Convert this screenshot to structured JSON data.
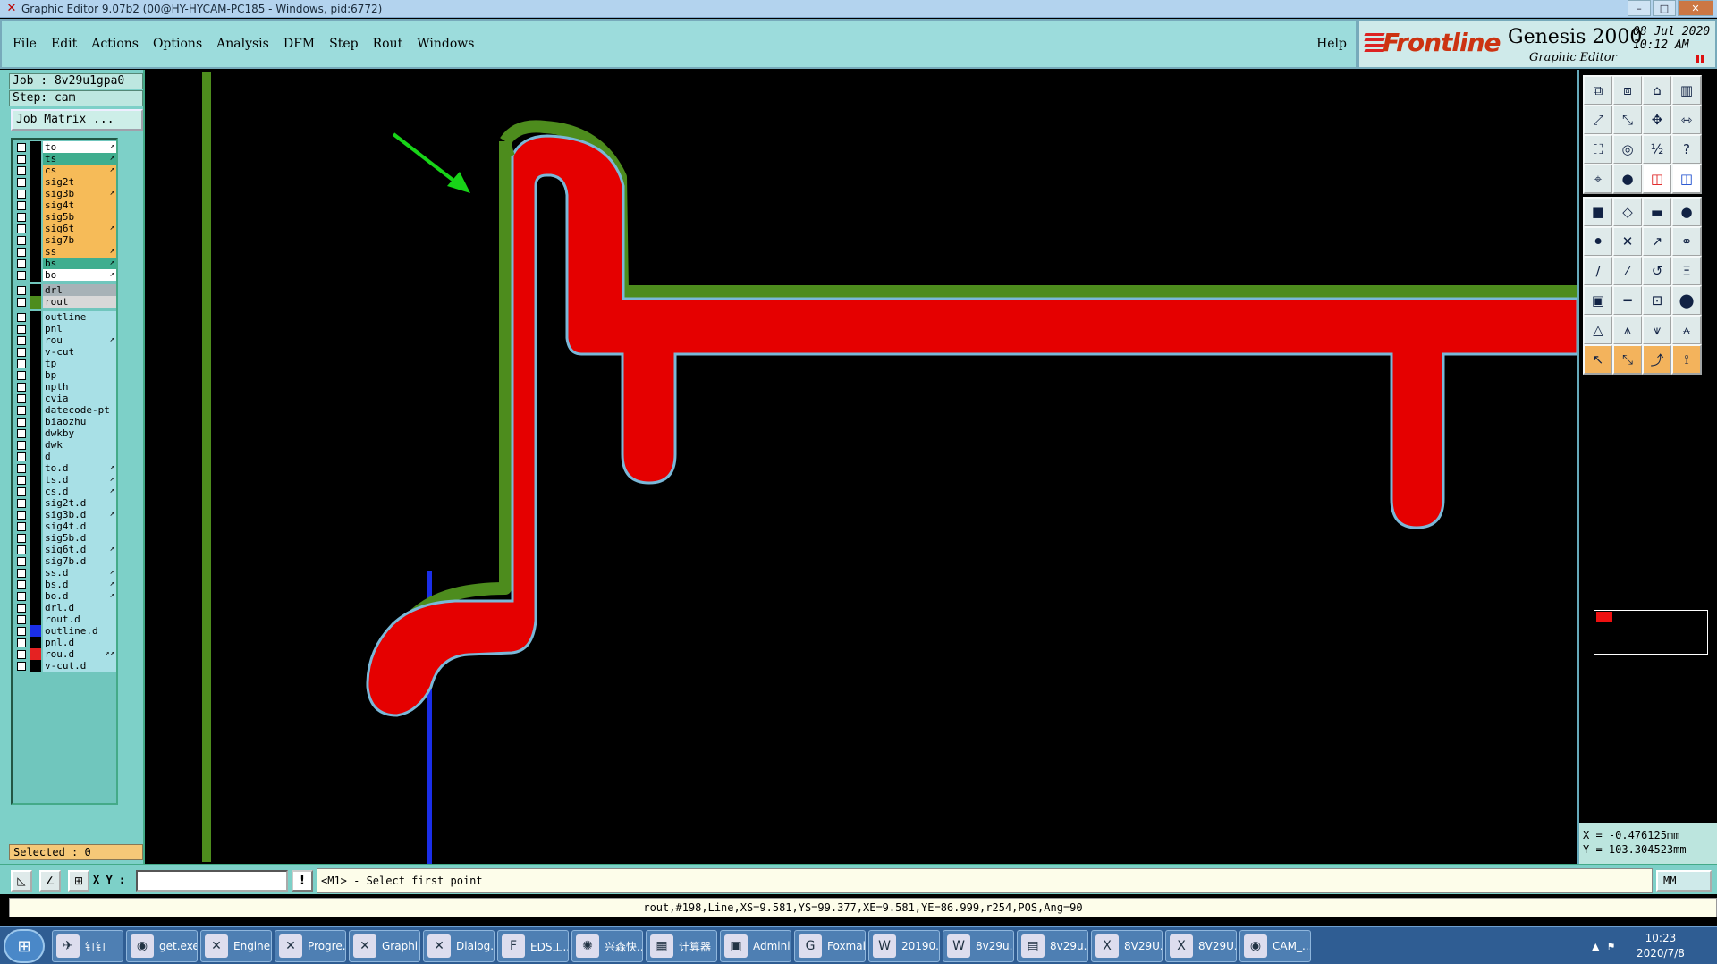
{
  "window": {
    "title": "Graphic Editor 9.07b2 (00@HY-HYCAM-PC185 - Windows, pid:6772)",
    "icon": "app-x-icon"
  },
  "menu": {
    "items": [
      {
        "label": "File"
      },
      {
        "label": "Edit"
      },
      {
        "label": "Actions"
      },
      {
        "label": "Options"
      },
      {
        "label": "Analysis"
      },
      {
        "label": "DFM"
      },
      {
        "label": "Step"
      },
      {
        "label": "Rout"
      },
      {
        "label": "Windows"
      }
    ],
    "help": "Help"
  },
  "brand": {
    "logo_main": "Frontline",
    "product": "Genesis 2000",
    "subtitle": "Graphic Editor",
    "date_line1": "08 Jul 2020",
    "date_line2": "10:12 AM"
  },
  "job": {
    "job": "Job : 8v29u1gpa0",
    "step": "Step: cam",
    "matrix_button": "Job Matrix ..."
  },
  "layers": [
    {
      "name": "to",
      "bg": "#ffffff",
      "mark": "↗"
    },
    {
      "name": "ts",
      "bg": "#3fae8f",
      "mark": "↗"
    },
    {
      "name": "cs",
      "bg": "#f6bb58",
      "mark": "↗"
    },
    {
      "name": "sig2t",
      "bg": "#f6bb58",
      "mark": ""
    },
    {
      "name": "sig3b",
      "bg": "#f6bb58",
      "mark": "↗"
    },
    {
      "name": "sig4t",
      "bg": "#f6bb58",
      "mark": ""
    },
    {
      "name": "sig5b",
      "bg": "#f6bb58",
      "mark": ""
    },
    {
      "name": "sig6t",
      "bg": "#f6bb58",
      "mark": "↗"
    },
    {
      "name": "sig7b",
      "bg": "#f6bb58",
      "mark": ""
    },
    {
      "name": "ss",
      "bg": "#f6bb58",
      "mark": "↗"
    },
    {
      "name": "bs",
      "bg": "#3fae8f",
      "mark": "↗"
    },
    {
      "name": "bo",
      "bg": "#ffffff",
      "mark": "↗"
    },
    {
      "name": "drl",
      "bg": "#a7b2b7",
      "mark": ""
    },
    {
      "name": "rout",
      "bg": "#d8d8d8",
      "mark": "",
      "swatch": "#4d8c1d"
    },
    {
      "name": "outline",
      "bg": "#a8e0e6",
      "mark": ""
    },
    {
      "name": "pnl",
      "bg": "#a8e0e6",
      "mark": ""
    },
    {
      "name": "rou",
      "bg": "#a8e0e6",
      "mark": "↗"
    },
    {
      "name": "v-cut",
      "bg": "#a8e0e6",
      "mark": ""
    },
    {
      "name": "tp",
      "bg": "#a8e0e6",
      "mark": ""
    },
    {
      "name": "bp",
      "bg": "#a8e0e6",
      "mark": ""
    },
    {
      "name": "npth",
      "bg": "#a8e0e6",
      "mark": ""
    },
    {
      "name": "cvia",
      "bg": "#a8e0e6",
      "mark": ""
    },
    {
      "name": "datecode-pt",
      "bg": "#a8e0e6",
      "mark": ""
    },
    {
      "name": "biaozhu",
      "bg": "#a8e0e6",
      "mark": ""
    },
    {
      "name": "dwkby",
      "bg": "#a8e0e6",
      "mark": ""
    },
    {
      "name": "dwk",
      "bg": "#a8e0e6",
      "mark": ""
    },
    {
      "name": "d",
      "bg": "#a8e0e6",
      "mark": ""
    },
    {
      "name": "to.d",
      "bg": "#a8e0e6",
      "mark": "↗"
    },
    {
      "name": "ts.d",
      "bg": "#a8e0e6",
      "mark": "↗"
    },
    {
      "name": "cs.d",
      "bg": "#a8e0e6",
      "mark": "↗"
    },
    {
      "name": "sig2t.d",
      "bg": "#a8e0e6",
      "mark": ""
    },
    {
      "name": "sig3b.d",
      "bg": "#a8e0e6",
      "mark": "↗"
    },
    {
      "name": "sig4t.d",
      "bg": "#a8e0e6",
      "mark": ""
    },
    {
      "name": "sig5b.d",
      "bg": "#a8e0e6",
      "mark": ""
    },
    {
      "name": "sig6t.d",
      "bg": "#a8e0e6",
      "mark": "↗"
    },
    {
      "name": "sig7b.d",
      "bg": "#a8e0e6",
      "mark": ""
    },
    {
      "name": "ss.d",
      "bg": "#a8e0e6",
      "mark": "↗"
    },
    {
      "name": "bs.d",
      "bg": "#a8e0e6",
      "mark": "↗"
    },
    {
      "name": "bo.d",
      "bg": "#a8e0e6",
      "mark": "↗"
    },
    {
      "name": "drl.d",
      "bg": "#a8e0e6",
      "mark": ""
    },
    {
      "name": "rout.d",
      "bg": "#a8e0e6",
      "mark": ""
    },
    {
      "name": "outline.d",
      "bg": "#a8e0e6",
      "mark": "",
      "swatch": "#1a2ee8"
    },
    {
      "name": "pnl.d",
      "bg": "#a8e0e6",
      "mark": ""
    },
    {
      "name": "rou.d",
      "bg": "#a8e0e6",
      "mark": "↗↗",
      "swatch": "#e52222"
    },
    {
      "name": "v-cut.d",
      "bg": "#a8e0e6",
      "mark": ""
    }
  ],
  "selected": "Selected : 0",
  "toolbox": {
    "icons": [
      "copy-to-layer-icon",
      "move-to-layer-icon",
      "home-icon",
      "panel-icon",
      "zoom-in-icon",
      "zoom-out-icon",
      "pan-icon",
      "split-icon",
      "fit-icon",
      "center-icon",
      "scale-1-2-icon",
      "help-icon",
      "snap-icon",
      "measure-icon",
      "red-layer-icon",
      "blue-layer-icon",
      "pad-icon",
      "surface-icon",
      "ruler-icon",
      "dot-icon",
      "node-icon",
      "cross-icon",
      "point-icon",
      "connect-icon",
      "line-icon",
      "slash-icon",
      "arc-icon",
      "text-icon",
      "pad-add-icon",
      "minus-icon",
      "grid-icon",
      "round-icon",
      "triangle-icon",
      "triangle-a-icon",
      "triangle-b-icon",
      "triangle-c-icon",
      "select-arrow-icon",
      "select-box-icon",
      "select-lasso-icon",
      "select-net-icon"
    ],
    "coord_x": "X = -0.476125mm",
    "coord_y": "Y = 103.304523mm"
  },
  "command": {
    "xy_label": "X Y :",
    "xy_value": "",
    "prompt": "<M1> - Select first point",
    "units": "MM"
  },
  "status": "rout,#198,Line,XS=9.581,YS=99.377,XE=9.581,YE=86.999,r254,POS,Ang=90",
  "taskbar": {
    "items": [
      {
        "label": "钉钉",
        "icon": "dingtalk-icon"
      },
      {
        "label": "get.exe",
        "icon": "eye-icon"
      },
      {
        "label": "Engine...",
        "icon": "x-window-icon"
      },
      {
        "label": "Progre...",
        "icon": "x-window-icon"
      },
      {
        "label": "Graphi...",
        "icon": "x-window-icon"
      },
      {
        "label": "Dialog...",
        "icon": "x-window-icon"
      },
      {
        "label": "EDS工...",
        "icon": "eds-icon"
      },
      {
        "label": "兴森快...",
        "icon": "shell-icon"
      },
      {
        "label": "计算器",
        "icon": "calculator-icon"
      },
      {
        "label": "Admini...",
        "icon": "floppy-icon"
      },
      {
        "label": "Foxmail",
        "icon": "foxmail-icon"
      },
      {
        "label": "20190...",
        "icon": "word-icon"
      },
      {
        "label": "8v29u...",
        "icon": "word-icon"
      },
      {
        "label": "8v29u...",
        "icon": "notepad-icon"
      },
      {
        "label": "8V29U...",
        "icon": "excel-icon"
      },
      {
        "label": "8V29U...",
        "icon": "excel-icon"
      },
      {
        "label": "CAM_...",
        "icon": "eye-icon"
      }
    ],
    "clock_time": "10:23",
    "clock_date": "2020/7/8"
  }
}
